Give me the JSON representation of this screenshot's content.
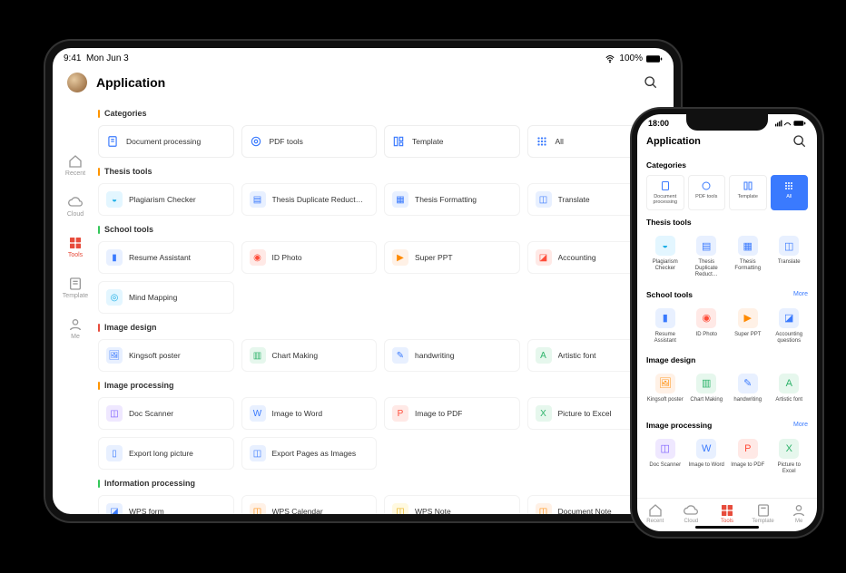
{
  "tablet": {
    "status": {
      "time": "9:41",
      "date": "Mon Jun 3",
      "battery": "100%"
    },
    "title": "Application",
    "sidebar": [
      {
        "label": "Recent"
      },
      {
        "label": "Cloud"
      },
      {
        "label": "Tools"
      },
      {
        "label": "Template"
      },
      {
        "label": "Me"
      }
    ],
    "sections": {
      "categories_title": "Categories",
      "categories": [
        {
          "label": "Document processing"
        },
        {
          "label": "PDF tools"
        },
        {
          "label": "Template"
        },
        {
          "label": "All"
        }
      ],
      "thesis_title": "Thesis tools",
      "thesis": [
        {
          "label": "Plagiarism Checker"
        },
        {
          "label": "Thesis Duplicate Reduct…"
        },
        {
          "label": "Thesis Formatting"
        },
        {
          "label": "Translate"
        }
      ],
      "school_title": "School tools",
      "school": [
        {
          "label": "Resume Assistant"
        },
        {
          "label": "ID Photo"
        },
        {
          "label": "Super PPT"
        },
        {
          "label": "Accounting"
        },
        {
          "label": "Mind Mapping"
        }
      ],
      "imgdesign_title": "Image design",
      "imgdesign": [
        {
          "label": "Kingsoft  poster"
        },
        {
          "label": "Chart Making"
        },
        {
          "label": "handwriting"
        },
        {
          "label": "Artistic font"
        }
      ],
      "imgproc_title": "Image processing",
      "imgproc": [
        {
          "label": "Doc Scanner"
        },
        {
          "label": "Image to Word"
        },
        {
          "label": "Image to PDF"
        },
        {
          "label": "Picture to Excel"
        },
        {
          "label": "Export long picture"
        },
        {
          "label": "Export Pages as Images"
        }
      ],
      "info_title": "Information processing",
      "info": [
        {
          "label": "WPS form"
        },
        {
          "label": "WPS Calendar"
        },
        {
          "label": "WPS Note"
        },
        {
          "label": "Document Note"
        }
      ]
    }
  },
  "phone": {
    "status_time": "18:00",
    "title": "Application",
    "categories_title": "Categories",
    "categories": [
      {
        "label": "Document processing"
      },
      {
        "label": "PDF tools"
      },
      {
        "label": "Template"
      },
      {
        "label": "All"
      }
    ],
    "thesis_title": "Thesis tools",
    "thesis": [
      {
        "label": "Plagiarism Checker"
      },
      {
        "label": "Thesis Duplicate Reduct…"
      },
      {
        "label": "Thesis Formatting"
      },
      {
        "label": "Translate"
      }
    ],
    "school_title": "School tools",
    "school_more": "More",
    "school": [
      {
        "label": "Resume Assistant"
      },
      {
        "label": "ID Photo"
      },
      {
        "label": "Super PPT"
      },
      {
        "label": "Accounting questions"
      }
    ],
    "imgdesign_title": "Image design",
    "imgdesign": [
      {
        "label": "Kingsoft  poster"
      },
      {
        "label": "Chart Making"
      },
      {
        "label": "handwriting"
      },
      {
        "label": "Artistic font"
      }
    ],
    "imgproc_title": "Image processing",
    "imgproc_more": "More",
    "imgproc": [
      {
        "label": "Doc Scanner"
      },
      {
        "label": "Image to Word"
      },
      {
        "label": "Image to PDF"
      },
      {
        "label": "Picture to Excel"
      }
    ],
    "tabbar": [
      {
        "label": "Recent"
      },
      {
        "label": "Cloud"
      },
      {
        "label": "Tools"
      },
      {
        "label": "Template"
      },
      {
        "label": "Me"
      }
    ]
  }
}
